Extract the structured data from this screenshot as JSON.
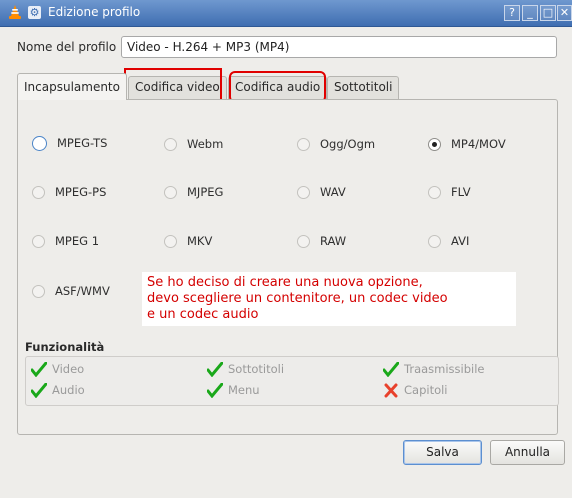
{
  "window": {
    "title": "Edizione profilo",
    "help": "?",
    "minimize": "_",
    "maximize": "□",
    "close": "✕"
  },
  "profile": {
    "label": "Nome del profilo",
    "value": "Video - H.264 + MP3 (MP4)"
  },
  "tabs": [
    {
      "label": "Incapsulamento",
      "active": true
    },
    {
      "label": "Codifica video",
      "active": false
    },
    {
      "label": "Codifica audio",
      "active": false
    },
    {
      "label": "Sottotitoli",
      "active": false
    }
  ],
  "containers": [
    {
      "label": "MPEG-TS",
      "state": "focus"
    },
    {
      "label": "Webm",
      "state": "off"
    },
    {
      "label": "Ogg/Ogm",
      "state": "off"
    },
    {
      "label": "MP4/MOV",
      "state": "checked"
    },
    {
      "label": "MPEG-PS",
      "state": "off"
    },
    {
      "label": "MJPEG",
      "state": "off"
    },
    {
      "label": "WAV",
      "state": "off"
    },
    {
      "label": "FLV",
      "state": "off"
    },
    {
      "label": "MPEG 1",
      "state": "off"
    },
    {
      "label": "MKV",
      "state": "off"
    },
    {
      "label": "RAW",
      "state": "off"
    },
    {
      "label": "AVI",
      "state": "off"
    },
    {
      "label": "ASF/WMV",
      "state": "off"
    }
  ],
  "annotation": [
    "Se ho deciso di creare una nuova opzione,",
    "devo scegliere un contenitore, un codec video",
    "e un codec audio"
  ],
  "features": {
    "title": "Funzionalità",
    "items": [
      {
        "label": "Video",
        "supported": true,
        "icon": "checkmark-icon"
      },
      {
        "label": "Sottotitoli",
        "supported": true,
        "icon": "checkmark-icon"
      },
      {
        "label": "Traasmissibile",
        "supported": true,
        "icon": "checkmark-icon"
      },
      {
        "label": "Audio",
        "supported": true,
        "icon": "checkmark-icon"
      },
      {
        "label": "Menu",
        "supported": true,
        "icon": "checkmark-icon"
      },
      {
        "label": "Capitoli",
        "supported": false,
        "icon": "cross-icon"
      }
    ]
  },
  "buttons": {
    "save": "Salva",
    "cancel": "Annulla"
  },
  "colors": {
    "titlebar": "#4f7fc0",
    "highlight": "#e00000",
    "annotation_text": "#d40000",
    "check": "#1aa81a",
    "cross": "#e8412c"
  }
}
